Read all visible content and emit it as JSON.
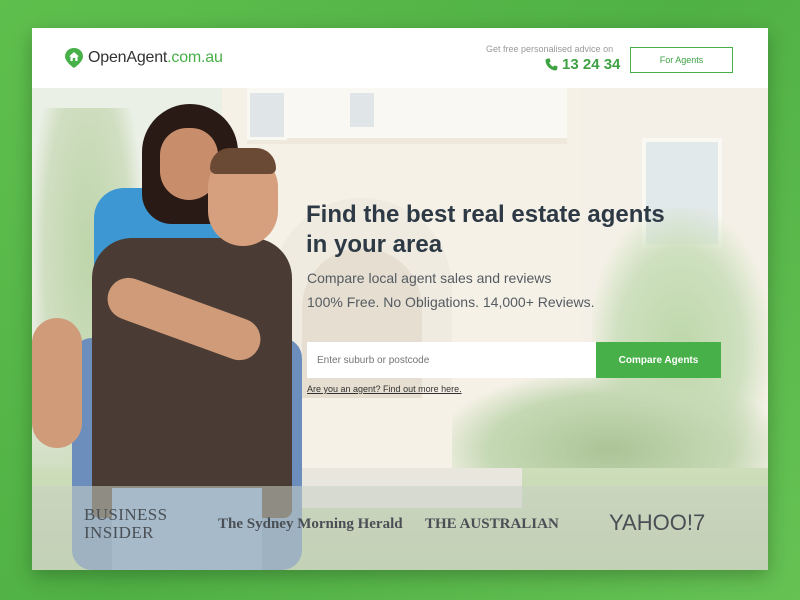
{
  "header": {
    "logo_name": "OpenAgent",
    "logo_domain": ".com.au",
    "advice_text": "Get free personalised advice on",
    "phone": "13 24 34",
    "for_agents_label": "For Agents"
  },
  "hero": {
    "headline_line1": "Find the best real estate agents",
    "headline_line2": "in your area",
    "sub_line1": "Compare local agent sales and reviews",
    "sub_line2": "100% Free. No Obligations. 14,000+ Reviews.",
    "search_placeholder": "Enter suburb or postcode",
    "compare_button": "Compare Agents",
    "agent_link": "Are you an agent? Find out more here."
  },
  "press_logos": {
    "business_insider_line1": "BUSINESS",
    "business_insider_line2": "INSIDER",
    "smh": "The Sydney Morning Herald",
    "australian": "THE AUSTRALIAN",
    "yahoo": "YAHOO!7"
  },
  "colors": {
    "brand_green": "#48b048",
    "headline": "#2d3a45",
    "page_bg": "#5fbf4d"
  },
  "icons": {
    "logo": "house-pin-icon",
    "phone": "phone-icon"
  }
}
